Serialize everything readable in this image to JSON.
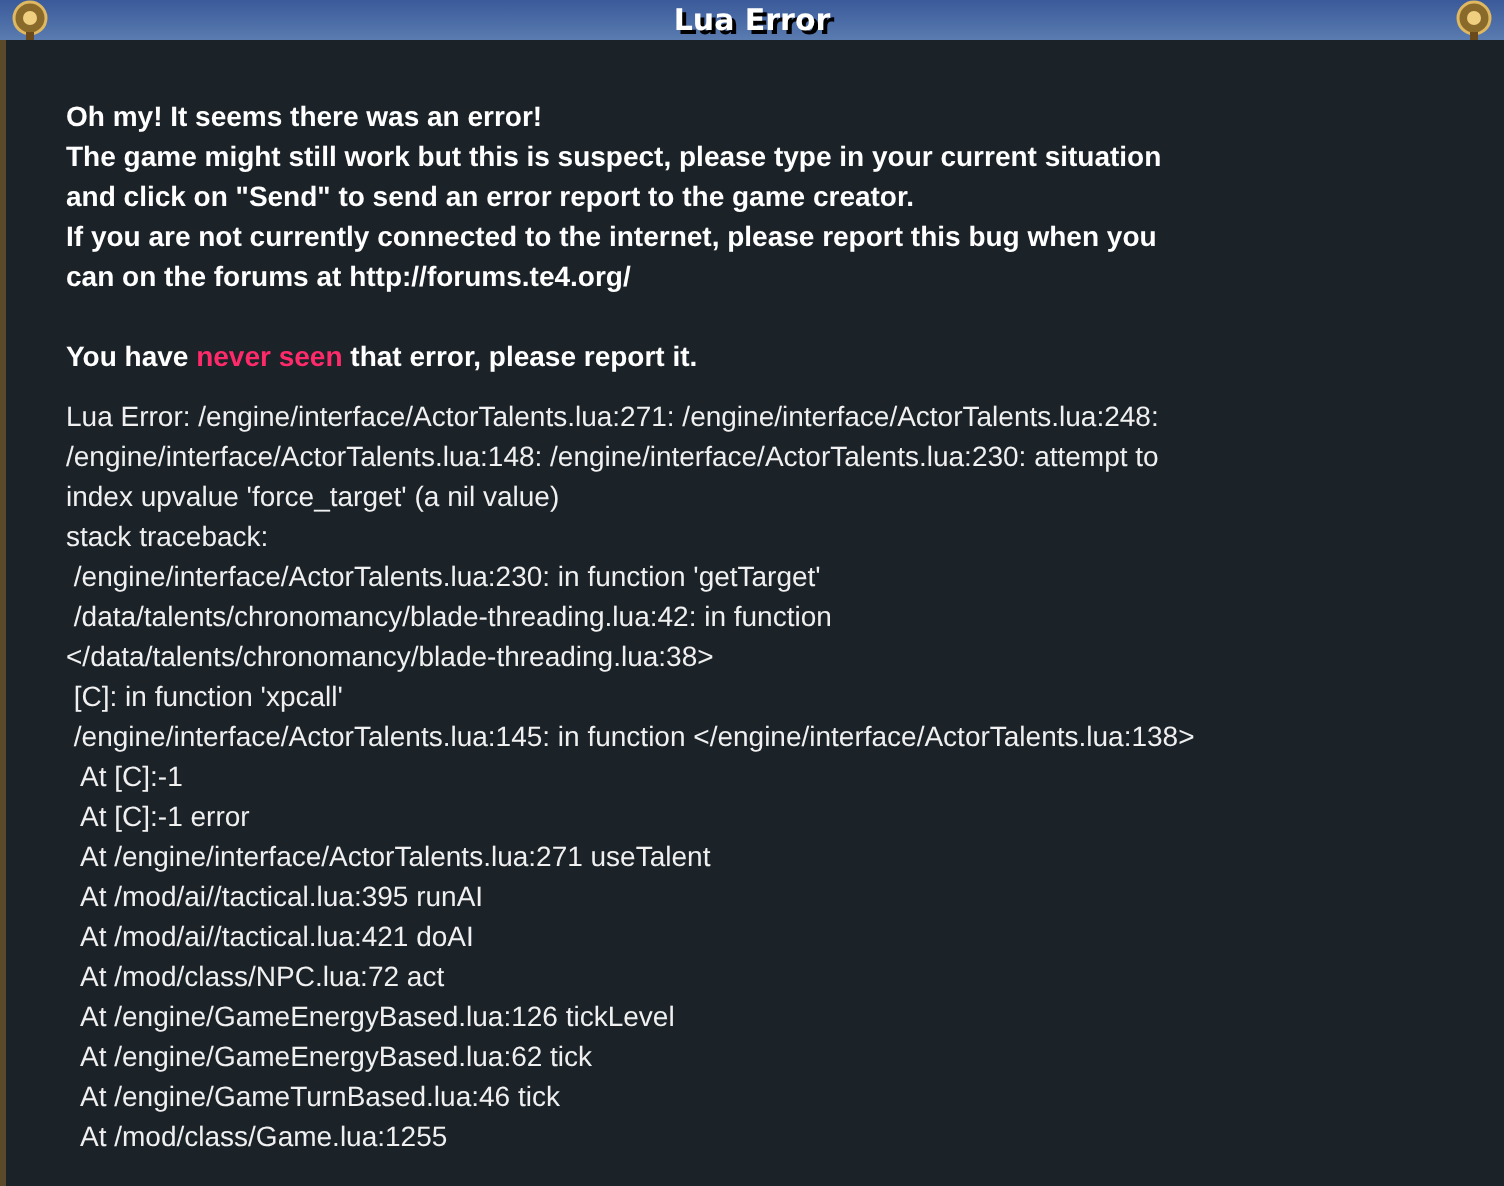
{
  "window": {
    "title": "Lua Error"
  },
  "intro_lines": [
    "Oh my! It seems there was an error!",
    "The game might still work but this is suspect, please type in your current situation",
    "and click on \"Send\" to send an error report to the game creator.",
    "If you are not currently connected to the internet, please report this bug when you",
    "can on the forums at http://forums.te4.org/"
  ],
  "notice": {
    "before": "You have ",
    "highlight": "never seen",
    "after": " that error, please report it."
  },
  "trace_lines": [
    "Lua Error: /engine/interface/ActorTalents.lua:271: /engine/interface/ActorTalents.lua:248:",
    "/engine/interface/ActorTalents.lua:148: /engine/interface/ActorTalents.lua:230: attempt to",
    "index upvalue 'force_target' (a nil value)",
    "stack traceback:",
    " /engine/interface/ActorTalents.lua:230: in function 'getTarget'",
    " /data/talents/chronomancy/blade-threading.lua:42: in function",
    "</data/talents/chronomancy/blade-threading.lua:38>",
    " [C]: in function 'xpcall'",
    " /engine/interface/ActorTalents.lua:145: in function </engine/interface/ActorTalents.lua:138>",
    "  At [C]:-1",
    "  At [C]:-1 error",
    "  At /engine/interface/ActorTalents.lua:271 useTalent",
    "  At /mod/ai//tactical.lua:395 runAI",
    "  At /mod/ai//tactical.lua:421 doAI",
    "  At /mod/class/NPC.lua:72 act",
    "  At /engine/GameEnergyBased.lua:126 tickLevel",
    "  At /engine/GameEnergyBased.lua:62 tick",
    "  At /engine/GameTurnBased.lua:46 tick",
    "  At /mod/class/Game.lua:1255"
  ]
}
